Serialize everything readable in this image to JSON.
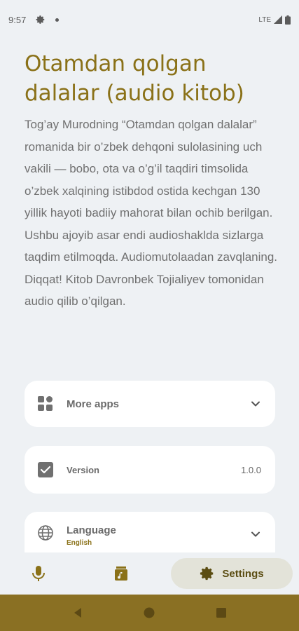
{
  "status": {
    "time": "9:57",
    "network": "LTE"
  },
  "book": {
    "title": "Otamdan qolgan dalalar (audio kitob)",
    "description": "Tog’ay Murodning “Otamdan qolgan dalalar” romanida bir o’zbek dehqoni sulolasining uch vakili — bobo, ota va o’g’il taqdiri timsolida o’zbek xalqining istibdod ostida kechgan 130 yillik hayoti badiiy mahorat bilan ochib berilgan. Ushbu ajoyib asar endi audioshaklda sizlarga taqdim etilmoqda. Audiomutolaadan zavqlaning.",
    "note": "Diqqat! Kitob Davronbek Tojialiyev tomonidan audio qilib o’qilgan."
  },
  "settings": {
    "more_apps_label": "More apps",
    "version_label": "Version",
    "version_value": "1.0.0",
    "language_label": "Language",
    "language_value": "English"
  },
  "nav": {
    "settings_label": "Settings"
  },
  "colors": {
    "accent": "#8a7118",
    "background": "#eef1f4",
    "system_nav": "#8a7023"
  }
}
